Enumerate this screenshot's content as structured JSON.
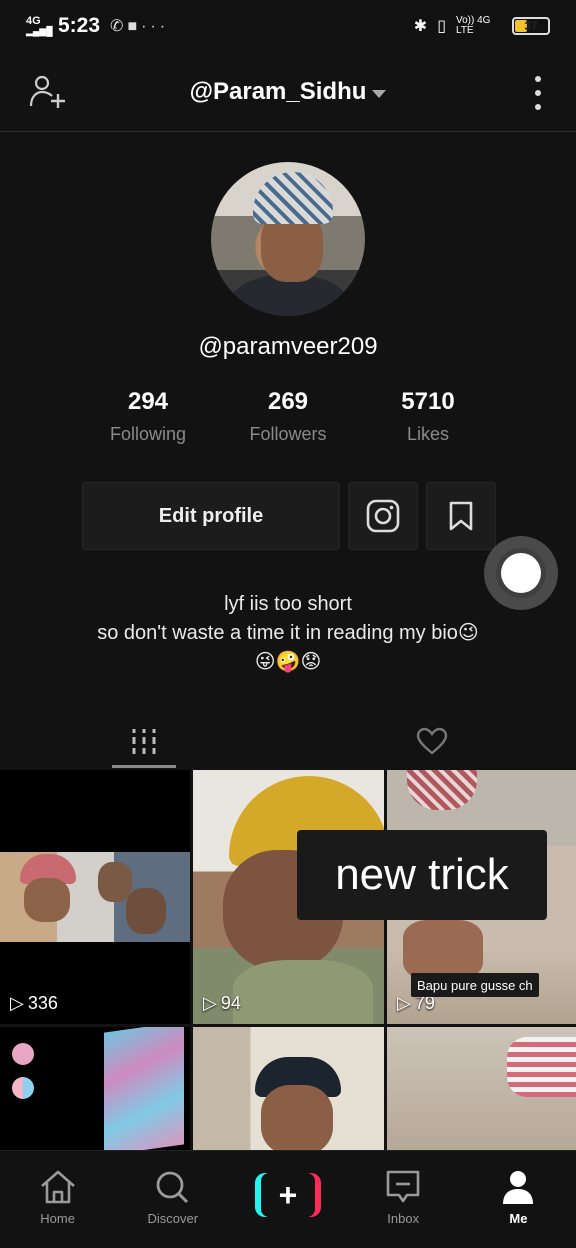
{
  "status_bar": {
    "network": "4G",
    "time": "5:23",
    "battery": "37",
    "volte": "Vo)) 4G LTE"
  },
  "header": {
    "title": "@Param_Sidhu"
  },
  "profile": {
    "username": "@paramveer209",
    "stats": [
      {
        "value": "294",
        "label": "Following"
      },
      {
        "value": "269",
        "label": "Followers"
      },
      {
        "value": "5710",
        "label": "Likes"
      }
    ],
    "edit_label": "Edit profile",
    "bio_line1": "lyf iis too short",
    "bio_line2": "so don't waste a time it in reading my bio😉",
    "bio_line3": "😜🤪😟"
  },
  "videos": [
    {
      "views": "336"
    },
    {
      "views": "94"
    },
    {
      "views": "79",
      "caption": "Bapu pure gusse ch"
    }
  ],
  "overlay_text": "new trick",
  "bottom_nav": {
    "home": "Home",
    "discover": "Discover",
    "inbox": "Inbox",
    "me": "Me"
  },
  "colors": {
    "accent_cyan": "#25f4ee",
    "accent_pink": "#fe2c55",
    "background": "#121212"
  }
}
